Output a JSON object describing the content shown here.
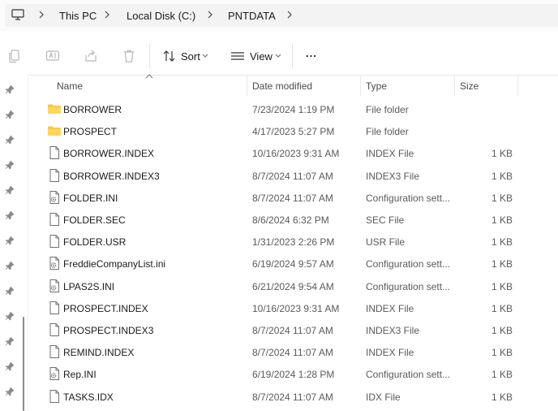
{
  "address": {
    "crumbs": [
      "This PC",
      "Local Disk (C:)",
      "PNTDATA"
    ]
  },
  "toolbar": {
    "sort_label": "Sort",
    "view_label": "View",
    "more_label": "..."
  },
  "columns": {
    "name": "Name",
    "date": "Date modified",
    "type": "Type",
    "size": "Size"
  },
  "files": [
    {
      "name": "BORROWER",
      "date": "7/23/2024 1:19 PM",
      "type": "File folder",
      "size": "",
      "icon": "folder-icon"
    },
    {
      "name": "PROSPECT",
      "date": "4/17/2023 5:27 PM",
      "type": "File folder",
      "size": "",
      "icon": "folder-icon"
    },
    {
      "name": "BORROWER.INDEX",
      "date": "10/16/2023 9:31 AM",
      "type": "INDEX File",
      "size": "1 KB",
      "icon": "file-icon"
    },
    {
      "name": "BORROWER.INDEX3",
      "date": "8/7/2024 11:07 AM",
      "type": "INDEX3 File",
      "size": "1 KB",
      "icon": "file-icon"
    },
    {
      "name": "FOLDER.INI",
      "date": "8/7/2024 11:07 AM",
      "type": "Configuration sett...",
      "size": "1 KB",
      "icon": "config-file-icon"
    },
    {
      "name": "FOLDER.SEC",
      "date": "8/6/2024 6:32 PM",
      "type": "SEC File",
      "size": "1 KB",
      "icon": "file-icon"
    },
    {
      "name": "FOLDER.USR",
      "date": "1/31/2023 2:26 PM",
      "type": "USR File",
      "size": "1 KB",
      "icon": "file-icon"
    },
    {
      "name": "FreddieCompanyList.ini",
      "date": "6/19/2024 9:57 AM",
      "type": "Configuration sett...",
      "size": "1 KB",
      "icon": "config-file-icon"
    },
    {
      "name": "LPAS2S.INI",
      "date": "6/21/2024 9:54 AM",
      "type": "Configuration sett...",
      "size": "1 KB",
      "icon": "config-file-icon"
    },
    {
      "name": "PROSPECT.INDEX",
      "date": "10/16/2023 9:31 AM",
      "type": "INDEX File",
      "size": "1 KB",
      "icon": "file-icon"
    },
    {
      "name": "PROSPECT.INDEX3",
      "date": "8/7/2024 11:07 AM",
      "type": "INDEX3 File",
      "size": "1 KB",
      "icon": "file-icon"
    },
    {
      "name": "REMIND.INDEX",
      "date": "8/7/2024 11:07 AM",
      "type": "INDEX File",
      "size": "1 KB",
      "icon": "file-icon"
    },
    {
      "name": "Rep.INI",
      "date": "6/19/2024 1:28 PM",
      "type": "Configuration sett...",
      "size": "1 KB",
      "icon": "config-file-icon"
    },
    {
      "name": "TASKS.IDX",
      "date": "8/7/2024 11:07 AM",
      "type": "IDX File",
      "size": "1 KB",
      "icon": "file-icon"
    }
  ]
}
